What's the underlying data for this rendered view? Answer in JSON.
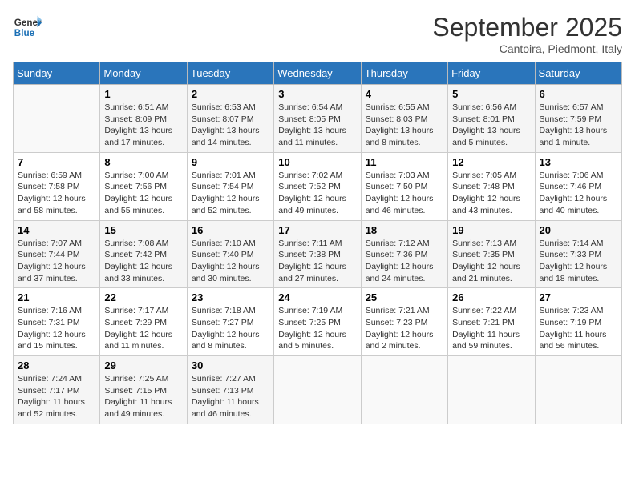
{
  "logo": {
    "line1": "General",
    "line2": "Blue"
  },
  "title": "September 2025",
  "subtitle": "Cantoira, Piedmont, Italy",
  "weekdays": [
    "Sunday",
    "Monday",
    "Tuesday",
    "Wednesday",
    "Thursday",
    "Friday",
    "Saturday"
  ],
  "weeks": [
    [
      {
        "day": "",
        "info": ""
      },
      {
        "day": "1",
        "info": "Sunrise: 6:51 AM\nSunset: 8:09 PM\nDaylight: 13 hours\nand 17 minutes."
      },
      {
        "day": "2",
        "info": "Sunrise: 6:53 AM\nSunset: 8:07 PM\nDaylight: 13 hours\nand 14 minutes."
      },
      {
        "day": "3",
        "info": "Sunrise: 6:54 AM\nSunset: 8:05 PM\nDaylight: 13 hours\nand 11 minutes."
      },
      {
        "day": "4",
        "info": "Sunrise: 6:55 AM\nSunset: 8:03 PM\nDaylight: 13 hours\nand 8 minutes."
      },
      {
        "day": "5",
        "info": "Sunrise: 6:56 AM\nSunset: 8:01 PM\nDaylight: 13 hours\nand 5 minutes."
      },
      {
        "day": "6",
        "info": "Sunrise: 6:57 AM\nSunset: 7:59 PM\nDaylight: 13 hours\nand 1 minute."
      }
    ],
    [
      {
        "day": "7",
        "info": "Sunrise: 6:59 AM\nSunset: 7:58 PM\nDaylight: 12 hours\nand 58 minutes."
      },
      {
        "day": "8",
        "info": "Sunrise: 7:00 AM\nSunset: 7:56 PM\nDaylight: 12 hours\nand 55 minutes."
      },
      {
        "day": "9",
        "info": "Sunrise: 7:01 AM\nSunset: 7:54 PM\nDaylight: 12 hours\nand 52 minutes."
      },
      {
        "day": "10",
        "info": "Sunrise: 7:02 AM\nSunset: 7:52 PM\nDaylight: 12 hours\nand 49 minutes."
      },
      {
        "day": "11",
        "info": "Sunrise: 7:03 AM\nSunset: 7:50 PM\nDaylight: 12 hours\nand 46 minutes."
      },
      {
        "day": "12",
        "info": "Sunrise: 7:05 AM\nSunset: 7:48 PM\nDaylight: 12 hours\nand 43 minutes."
      },
      {
        "day": "13",
        "info": "Sunrise: 7:06 AM\nSunset: 7:46 PM\nDaylight: 12 hours\nand 40 minutes."
      }
    ],
    [
      {
        "day": "14",
        "info": "Sunrise: 7:07 AM\nSunset: 7:44 PM\nDaylight: 12 hours\nand 37 minutes."
      },
      {
        "day": "15",
        "info": "Sunrise: 7:08 AM\nSunset: 7:42 PM\nDaylight: 12 hours\nand 33 minutes."
      },
      {
        "day": "16",
        "info": "Sunrise: 7:10 AM\nSunset: 7:40 PM\nDaylight: 12 hours\nand 30 minutes."
      },
      {
        "day": "17",
        "info": "Sunrise: 7:11 AM\nSunset: 7:38 PM\nDaylight: 12 hours\nand 27 minutes."
      },
      {
        "day": "18",
        "info": "Sunrise: 7:12 AM\nSunset: 7:36 PM\nDaylight: 12 hours\nand 24 minutes."
      },
      {
        "day": "19",
        "info": "Sunrise: 7:13 AM\nSunset: 7:35 PM\nDaylight: 12 hours\nand 21 minutes."
      },
      {
        "day": "20",
        "info": "Sunrise: 7:14 AM\nSunset: 7:33 PM\nDaylight: 12 hours\nand 18 minutes."
      }
    ],
    [
      {
        "day": "21",
        "info": "Sunrise: 7:16 AM\nSunset: 7:31 PM\nDaylight: 12 hours\nand 15 minutes."
      },
      {
        "day": "22",
        "info": "Sunrise: 7:17 AM\nSunset: 7:29 PM\nDaylight: 12 hours\nand 11 minutes."
      },
      {
        "day": "23",
        "info": "Sunrise: 7:18 AM\nSunset: 7:27 PM\nDaylight: 12 hours\nand 8 minutes."
      },
      {
        "day": "24",
        "info": "Sunrise: 7:19 AM\nSunset: 7:25 PM\nDaylight: 12 hours\nand 5 minutes."
      },
      {
        "day": "25",
        "info": "Sunrise: 7:21 AM\nSunset: 7:23 PM\nDaylight: 12 hours\nand 2 minutes."
      },
      {
        "day": "26",
        "info": "Sunrise: 7:22 AM\nSunset: 7:21 PM\nDaylight: 11 hours\nand 59 minutes."
      },
      {
        "day": "27",
        "info": "Sunrise: 7:23 AM\nSunset: 7:19 PM\nDaylight: 11 hours\nand 56 minutes."
      }
    ],
    [
      {
        "day": "28",
        "info": "Sunrise: 7:24 AM\nSunset: 7:17 PM\nDaylight: 11 hours\nand 52 minutes."
      },
      {
        "day": "29",
        "info": "Sunrise: 7:25 AM\nSunset: 7:15 PM\nDaylight: 11 hours\nand 49 minutes."
      },
      {
        "day": "30",
        "info": "Sunrise: 7:27 AM\nSunset: 7:13 PM\nDaylight: 11 hours\nand 46 minutes."
      },
      {
        "day": "",
        "info": ""
      },
      {
        "day": "",
        "info": ""
      },
      {
        "day": "",
        "info": ""
      },
      {
        "day": "",
        "info": ""
      }
    ]
  ]
}
